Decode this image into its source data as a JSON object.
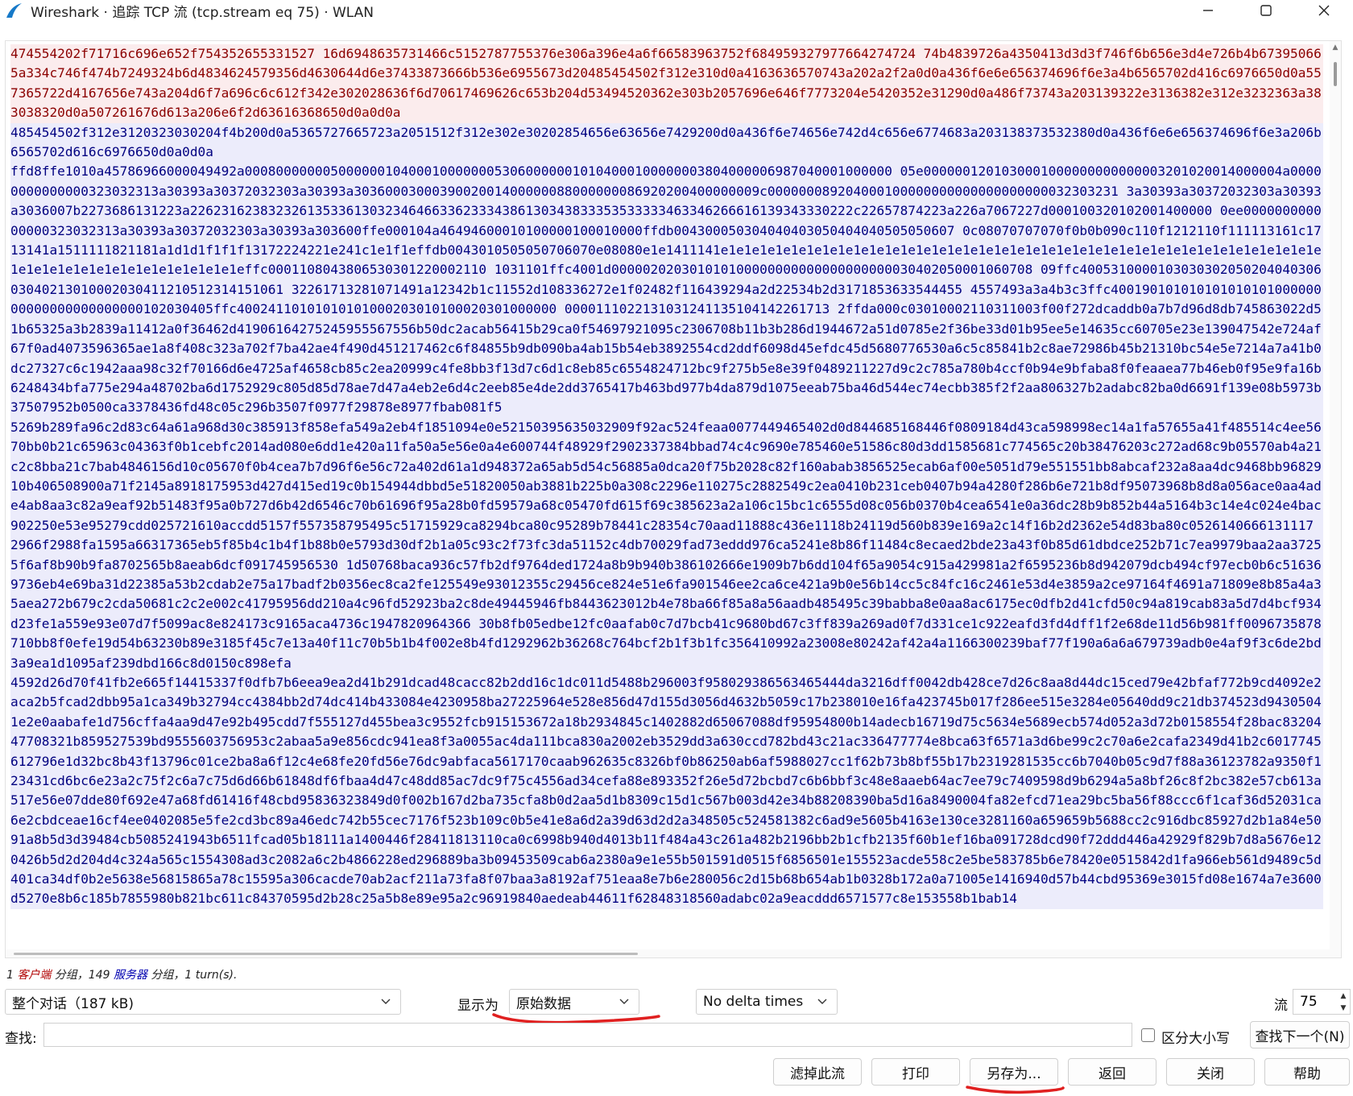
{
  "window": {
    "title": "Wireshark · 追踪 TCP 流 (tcp.stream eq 75) · WLAN"
  },
  "stream": {
    "blocks": [
      {
        "dir": "client",
        "text": "474554202f71716c696e652f754352655331527 16d6948635731466c5152787755376e306a396e4a6f66583963752f684959327977664274724 74b4839726a4350413d3d3f746f6b656e3d4e726b4b673950665a334c746f474b7249324b6d4834624579356d4630644d6e37433873666b536e6955673d20485454502f312e310d0a4163636570743a202a2f2a0d0a436f6e6e656374696f6e3a4b6565702d416c6976650d0a557365722d4167656e743a204d6f7a696c6c612f342e302028636f6d70617469626c653b204d53494520362e303b2057696e646f7773204e5420352e31290d0a486f73743a203139322e3136382e312e3232363a383038320d0a507261676d613a206e6f2d63616368650d0a0d0a"
      },
      {
        "dir": "server",
        "text": "485454502f312e3120323030204f4b200d0a5365727665723a2051512f312e302e30202854656e63656e7429200d0a436f6e74656e742d4c656e6774683a203138373532380d0a436f6e6e656374696f6e3a206b6565702d616c6976650d0a0d0a"
      },
      {
        "dir": "server",
        "text": "ffd8ffe1010a45786966000049492a00080000000500000010400010000000530600000010104000100000003804000006987040001000000 05e0000001201030001000000000000003201020014000004a00000000000000323032313a30393a30372032303a30393a3036000300039002001400000088000000086920200400000009c000000089204000100000000000000000000032303231 3a30393a30372032303a30393a3036007b2273686131223a2262316238323261353361303234646633623334386130343833353533333463346266616139343330222c22657874223a226a7067227d000100320102001400000 0ee000000000000000323032313a30393a30372032303a30393a303600ffe000104a46494600010100000100010000ffdb004300050304040403050404040505050607 0c08070707070f0b0b090c110f1212110f111113161c1713141a1511111821181a1d1d1f1f1f13172224221e241c1e1f1effdb0043010505050706070e08080e1e1411141e1e1e1e1e1e1e1e1e1e1e1e1e1e1e1e1e1e1e1e1e1e1e1e1e1e1e1e1e1e1e1e1e1e1e1e1e1e1e1e1e1e1e1e1e1e1e1e1e1e1e1e1e1effc0001108043806530301220002110 1031101ffc4001d000002020301010100000000000000000000030402050001060708 09ffc400531000010303030205020404030603040213010002030411210512314151061 32261713281071491a12342b1c11552d108336272e1f02482f116439294a2d22534b2d3171853633544455 4557493a3a4b3c3ffc40019010101010101010100000000000000000000000102030405ffc40024110101010101000203010100020301000000 0000111022131031241135104142261713 2ffda000c03010002110311003f00f272dcaddb0a7b7d96d8db745863022d51b65325a3b2839a11412a0f36462d41906164275245955567556b50dc2acab56415b29ca0f54697921095c2306708b11b3b286d1944672a51d0785e2f36be33d01b95ee5e14635cc60705e23e139047542e724af67f0ad4073596365ae1a8f408c323a702f7ba42ae4f490d451217462c6f84855b9db090ba4ab15b54eb3892554cd2ddf6098d45efdc45d5680776530a6c5c85841b2c8ae72986b45b21310bc54e5e7214a7a41b0dc27327c6c1942aaa98c32f70166d6e4725af4658cb85c2ea20999c4fe8bb3f13d7c6d1c8eb85c6554824712bc9f275b5e8e39f0489211227d9c2c785a780b4ccf0b94e9bfaba8f0feaaea77b46eb0f95e9fa16b6248434bfa775e294a48702ba6d1752929c805d85d78ae7d47a4eb2e6d4c2eeb85e4de2dd3765417b463bd977b4da879d1075eeab75ba46d544ec74ecbb385f2f2aa806327b2adabc82ba0d6691f139e08b5973b37507952b0500ca3378436fd48c05c296b3507f0977f29878e8977fbab081f5"
      },
      {
        "dir": "server",
        "text": "5269b289fa96c2d83c64a61a968d30c385913f858efa549a2eb4f1851094e0e52150395635032909f92ac524feaa0077449465402d0d844685168446f0809184d43ca598998ec14a1fa57655a41f485514c4ee5670bb0b21c65963c04363f0b1cebfc2014ad080e6dd1e420a11fa50a5e56e0a4e600744f48929f2902337384bbad74c4c9690e785460e51586c80d3dd1585681c774565c20b38476203c272ad68c9b05570ab4a21c2c8bba21c7bab4846156d10c05670f0b4cea7b7d96f6e56c72a402d61a1d948372a65ab5d54c56885a0dca20f75b2028c82f160abab3856525ecab6af00e5051d79e551551bb8abcaf232a8aa4dc9468bb9682910b406508900a71f2145a8918175953d427d415ed19c0b154944dbbd5e51820050ab3881b225b0a308c2296e110275c2882549c2ea0410b231ceb0407b94a4280f286b6e721b8df95073968b8d8a056ace0aa4ade4ab8aa3c82a9eaf92b51483f95a0b727d6b42d6546c70b61696f95a28b0fd59579a68c05470fd615f69c385623a2a106c15bc1c6555d08c056b0370b4cea6541e0a36dc28b9b852b44a5164b3c14e4c024e4bac902250e53e95279cdd025721610accdd5157f557358795495c51715929ca8294bca80c95289b78441c28354c70aad11888c436e1118b24119d560b839e169a2c14f16b2d2362e54d83ba80c0526140666131117 2966f2988fa1595a66317365eb5f85b4c1b4f1b88b0e5793d30df2b1a05c93c2f73fc3da51152c4db70029fad73eddd976ca5241e8b86f11484c8ecaed2bde23a43f0b85d61dbdce252b71c7ea9979baa2aa37255f6af8b90b9fa8702565b8aeab6dcf091745956530 1d50768baca936c57fb2df9764ded1724a8b9b940b386102666e1909b7b6dd104f65a9054c915a429981a2f6595236b8d942079dcb494cf97ecb0b6c516369736eb4e69ba31d22385a53b2cdab2e75a17badf2b0356ec8ca2fe125549e93012355c29456ce824e51e6fa901546ee2ca6ce421a9b0e56b14cc5c84fc16c2461e53d4e3859a2ce97164f4691a71809e8b85a4a35aea272b679c2cda50681c2c2e002c41795956dd210a4c96fd52923ba2c8de49445946fb8443623012b4e78ba66f85a8a56aadb485495c39babba8e0aa8ac6175ec0dfb2d41cfd50c94a819cab83a5d7d4bcf934d23fe1a559e93e07d7f5099ac8e824173c9165aca4736c1947820964366 30b8fb05edbe12fc0aafab0c7d7bcb41c9680bd67c3ff839a269ad0f7d331ce1c922eafd3fd4dff1f2e68de11d56b981ff0096735878710bb8f0efe19d54b63230b89e3185f45c7e13a40f11c70b5b1b4f002e8b4fd1292962b36268c764bcf2b1f3b1fc356410992a23008e80242af42a4a1166300239baf77f190a6a6a679739adb0e4af9f3c6de2bd3a9ea1d1095af239dbd166c8d0150c898efa"
      },
      {
        "dir": "server",
        "text": "4592d26d70f41fb2e665f14415337f0dfb7b6eea9ea2d41b291dcad48cacc82b2dd16c1dc011d5488b296003f958029386563465444da3216dff0042db428ce7d26c8aa8d44dc15ced79e42bfaf772b9cd4092e2aca2b5fcad2dbb95a1ca349b32794cc4384bb2d74dc414b433084e4230958ba27225964e528e856d47d155d3056d4632b5059c17b238010e16fa423745b017f286ee515e3284e05640dd9c21db374523d94305041e2e0aabafe1d756cffa4aa9d47e92b495cdd7f555127d455bea3c9552fcb915153672a18b2934845c1402882d65067088df95954800b14adecb16719d75c5634e5689ecb574d052a3d72b0158554f28bac8320447708321b859527539bd9555603756953c2abaa5a9e856cdc941ea8f3a0055ac4da111bca830a2002eb3529dd3a630ccd782bd43c21ac336477774e8bca63f6571a3d6be99c2c70a6e2cafa2349d41b2c6017745612796e1d32bc8b43f13796c01ce2ba8a6f12c4e68fe20fd56e76dc9abfaca5617170caab962635c8326bf0b86250ab6af5988027cc1f62b73b8bf55b17b2319281535cc6b7040b05c9d7f88a36123782a9350f123431cd6bc6e23a2c75f2c6a7c75d6d66b61848df6fbaa4d47c48dd85ac7dc9f75c4556ad34cefa88e893352f26e5d72bcbd7c6b6bbf3c48e8aaeb64ac7ee79c7409598d9b6294a5a8bf26c8f2bc382e57cb613a517e56e07dde80f692e47a68fd61416f48cbd95836323849d0f002b167d2ba735cfa8b0d2aa5d1b8309c15d1c567b003d42e34b88208390ba5d16a8490004fa82efcd71ea29bc5ba56f88ccc6f1caf36d52031ca6e2cbdceae16cf4ee0402085e5fe2cd3bc89a46edc742b55cec7176f523b109c0b5e41e8a6d2a39d63d2d2a348505c524581382c6ad9e5605b4163e130ce3281160a659659b5688cc2c916dbc85927d2b1a84e5091a8b5d3d39484cb5085241943b6511fcad05b18111a1400446f28411813110ca0c6998b940d4013b11f484a43c261a482b2196bb2b1cfb2135f60b1ef16ba091728dcd90f72ddd446a42929f829b7d8a5676e120426b5d2d204d4c324a565c1554308ad3c2082a6c2b4866228ed296889ba3b09453509cab6a2380a9e1e55b501591d0515f6856501e155523acde558c2e5be583785b6e78420e0515842d1fa966eb561d9489c5d401ca34df0b2e5638e56815865a78c15595a306cacde70ab2acf211a73fa8f07baa3a8192af751eaa8e7b6e280056c2d15b68b654ab1b0328b172a0a71005e1416940d57b44cbd95369e3015fd08e1674a7e3600d5270e8b6c185b7855980b821bc611c84370595d2b28c25a5b8e89e95a2c96919840aedeab44611f62848318560adabc02a9eacddd6571577c8e153558b1bab14"
      }
    ]
  },
  "summary": {
    "prefix": "1 ",
    "client_word": "客户端",
    "mid": " 分组，149 ",
    "server_word": "服务器",
    "suffix": " 分组，1 turn(s)."
  },
  "controls": {
    "conversation_select": "整个对话（187 kB)",
    "show_as_label": "显示为",
    "show_as_value": "原始数据",
    "delta_select": "No delta times",
    "stream_label": "流",
    "stream_value": "75",
    "find_label": "查找:",
    "find_placeholder": "",
    "case_sensitive_label": "区分大小写",
    "find_next_button": "查找下一个(N)"
  },
  "buttons": {
    "filter_out": "滤掉此流",
    "print": "打印",
    "save_as": "另存为...",
    "back": "返回",
    "close": "关闭",
    "help": "帮助"
  },
  "colors": {
    "client_text": "#8b0000",
    "client_bg": "#fbeced",
    "server_text": "#000080",
    "server_bg": "#ececfb",
    "annotation_red": "#e02020"
  },
  "icons": {
    "app_logo": "wireshark-fin-icon",
    "minimize": "minimize-icon",
    "maximize": "maximize-icon",
    "close": "close-icon",
    "dropdown": "chevron-down-icon"
  }
}
